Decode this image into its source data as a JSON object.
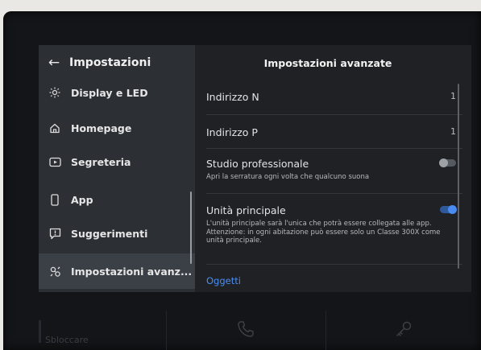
{
  "sidebar": {
    "back_label": "←",
    "title": "Impostazioni",
    "items": [
      {
        "label": "Display e LED",
        "icon": "sun-icon"
      },
      {
        "label": "Homepage",
        "icon": "home-icon"
      },
      {
        "label": "Segreteria",
        "icon": "voicemail-icon"
      },
      {
        "label": "App",
        "icon": "smartphone-icon"
      },
      {
        "label": "Suggerimenti",
        "icon": "feedback-icon"
      },
      {
        "label": "Impostazioni avanz...",
        "icon": "advanced-settings-icon",
        "active": true
      }
    ]
  },
  "main": {
    "title": "Impostazioni avanzate",
    "rows": [
      {
        "label": "Indirizzo N",
        "value": "1"
      },
      {
        "label": "Indirizzo P",
        "value": "1"
      },
      {
        "label": "Studio professionale",
        "description": "Apri la serratura ogni volta che qualcuno suona",
        "toggle": false
      },
      {
        "label": "Unità principale",
        "description": "L'unità principale sarà l'unica che potrà essere collegata alle app. Attenzione: in ogni abitazione può essere solo un Classe 300X come unità principale.",
        "toggle": true
      }
    ],
    "link": "Oggetti"
  },
  "bottom_bar": {
    "left_label": "Sbloccare",
    "call_icon": "phone-icon",
    "key_icon": "key-icon"
  },
  "colors": {
    "accent": "#4a8bf0",
    "background": "#1f2125",
    "sidebar": "#2c2f34"
  }
}
